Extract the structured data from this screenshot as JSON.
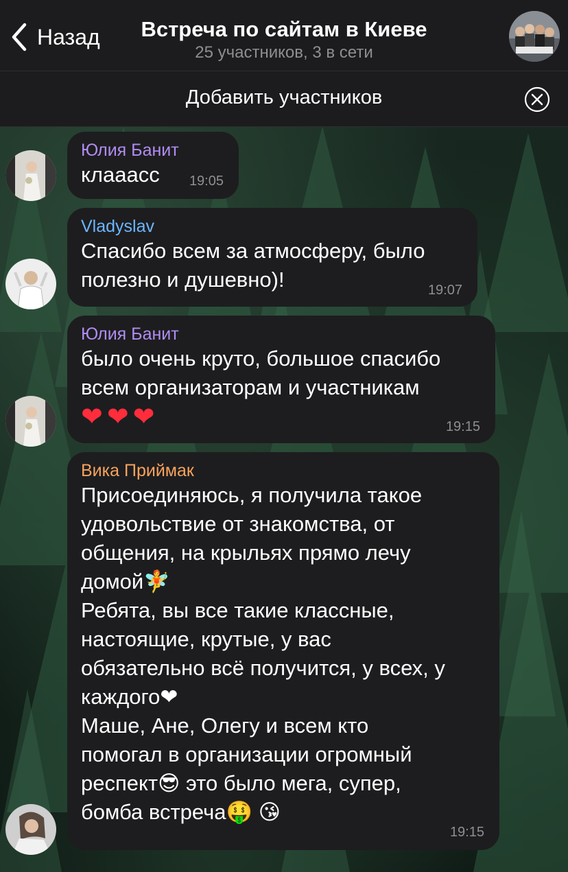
{
  "header": {
    "back_label": "Назад",
    "title": "Встреча по сайтам в Киеве",
    "subtitle": "25 участников, 3 в сети"
  },
  "add_bar": {
    "label": "Добавить участников"
  },
  "colors": {
    "sender_yulia": "#b18cf2",
    "sender_vladyslav": "#6cb6ff",
    "sender_vika": "#f7a35c",
    "bubble": "#1d1d1f",
    "time": "#8e8e93"
  },
  "messages": [
    {
      "sender": "Юлия Банит",
      "lines": [
        "клааасс"
      ],
      "time": "19:05"
    },
    {
      "sender": "Vladyslav",
      "lines": [
        "Спасибо всем за атмосферу, было",
        "полезно и душевно)!"
      ],
      "time": "19:07"
    },
    {
      "sender": "Юлия Банит",
      "lines": [
        "было очень круто, большое спасибо",
        "всем организаторам и участникам",
        "❤❤❤"
      ],
      "time": "19:15"
    },
    {
      "sender": "Вика Приймак",
      "lines": [
        "Присоединяюсь, я получила такое",
        "удовольствие от знакомства, от",
        "общения, на крыльях прямо лечу",
        "домой🧚",
        "Ребята, вы все такие классные,",
        "настоящие, крутые, у вас",
        "обязательно всё получится, у всех, у",
        "каждого❤",
        "Маше, Ане, Олегу и всем кто",
        "помогал в организации огромный",
        "респект😎 это было мега, супер,",
        "бомба встреча🤑 😘"
      ],
      "time": "19:15"
    }
  ]
}
